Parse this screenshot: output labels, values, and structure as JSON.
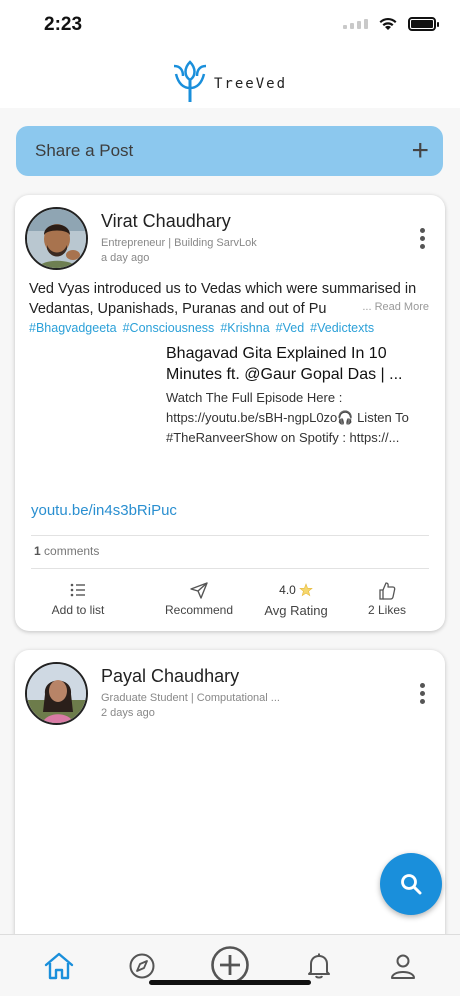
{
  "status_bar": {
    "time": "2:23"
  },
  "header": {
    "logo_text": "TreeVed",
    "accent_color": "#1a8fdb"
  },
  "share": {
    "label": "Share a Post",
    "plus": "+"
  },
  "posts": [
    {
      "author": "Virat Chaudhary",
      "headline": "Entrepreneur | Building SarvLok",
      "time": "a day ago",
      "text": "Ved Vyas introduced us to Vedas which were summarised in Vedantas, Upanishads, Puranas and out of Pu",
      "read_more": "... Read More",
      "hashtags": [
        "#Bhagvadgeeta",
        "#Consciousness",
        "#Krishna",
        "#Ved",
        "#Vedictexts"
      ],
      "link_title": "Bhagavad Gita Explained In 10 Minutes ft. @Gaur Gopal Das | ...",
      "link_desc": "Watch The Full Episode Here : https://youtu.be/sBH-ngpL0zo🎧 Listen To #TheRanveerShow on Spotify : https://...",
      "link_url": "youtu.be/in4s3bRiPuc",
      "comments_count": "1",
      "comments_label": "comments",
      "actions": {
        "add_to_list": "Add to list",
        "recommend": "Recommend",
        "rating_value": "4.0",
        "avg_rating": "Avg Rating",
        "likes_count": "2",
        "likes_label": "Likes"
      }
    },
    {
      "author": "Payal Chaudhary",
      "headline": "Graduate Student | Computational ...",
      "time": "2 days ago"
    }
  ],
  "fab": {
    "icon": "search-icon"
  },
  "bottom_nav": {
    "items": [
      "home-icon",
      "compass-icon",
      "add-circle-icon",
      "bell-icon",
      "profile-icon"
    ],
    "active": "home-icon"
  }
}
